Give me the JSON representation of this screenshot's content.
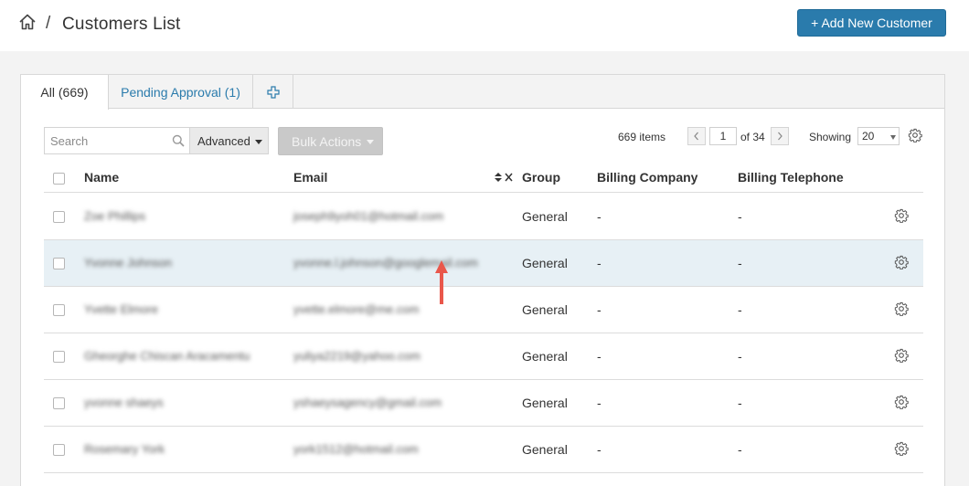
{
  "breadcrumb": {
    "separator": "/",
    "title": "Customers List"
  },
  "actions": {
    "add_customer": "+ Add New Customer"
  },
  "tabs": [
    {
      "label": "All (669)",
      "active": true
    },
    {
      "label": "Pending Approval (1)",
      "active": false
    }
  ],
  "toolbar": {
    "search_placeholder": "Search",
    "advanced_label": "Advanced",
    "bulk_label": "Bulk Actions"
  },
  "pagination": {
    "items": "669 items",
    "current_page": "1",
    "of_pages": "of 34",
    "showing_label": "Showing",
    "per_page": "20"
  },
  "columns": {
    "name": "Name",
    "email": "Email",
    "group": "Group",
    "billing_company": "Billing Company",
    "billing_telephone": "Billing Telephone"
  },
  "rows": [
    {
      "name": "Zoe Phillips",
      "email": "joseph9yoh01@hotmail.com",
      "group": "General",
      "billing_company": "-",
      "billing_telephone": "-",
      "highlighted": false
    },
    {
      "name": "Yvonne Johnson",
      "email": "yvonne.l.johnson@googlemail.com",
      "group": "General",
      "billing_company": "-",
      "billing_telephone": "-",
      "highlighted": true
    },
    {
      "name": "Yvette Elmore",
      "email": "yvette.elmore@me.com",
      "group": "General",
      "billing_company": "-",
      "billing_telephone": "-",
      "highlighted": false
    },
    {
      "name": "Gheorghe Chiscan Aracamentu",
      "email": "yuliya2219@yahoo.com",
      "group": "General",
      "billing_company": "-",
      "billing_telephone": "-",
      "highlighted": false
    },
    {
      "name": "yvonne shaeys",
      "email": "yshaeysagency@gmail.com",
      "group": "General",
      "billing_company": "-",
      "billing_telephone": "-",
      "highlighted": false
    },
    {
      "name": "Rosemary York",
      "email": "york1512@hotmail.com",
      "group": "General",
      "billing_company": "-",
      "billing_telephone": "-",
      "highlighted": false
    }
  ],
  "colors": {
    "accent": "#2a7bac",
    "highlight_row": "#e7f0f5",
    "annotation_arrow": "#e9574b"
  }
}
